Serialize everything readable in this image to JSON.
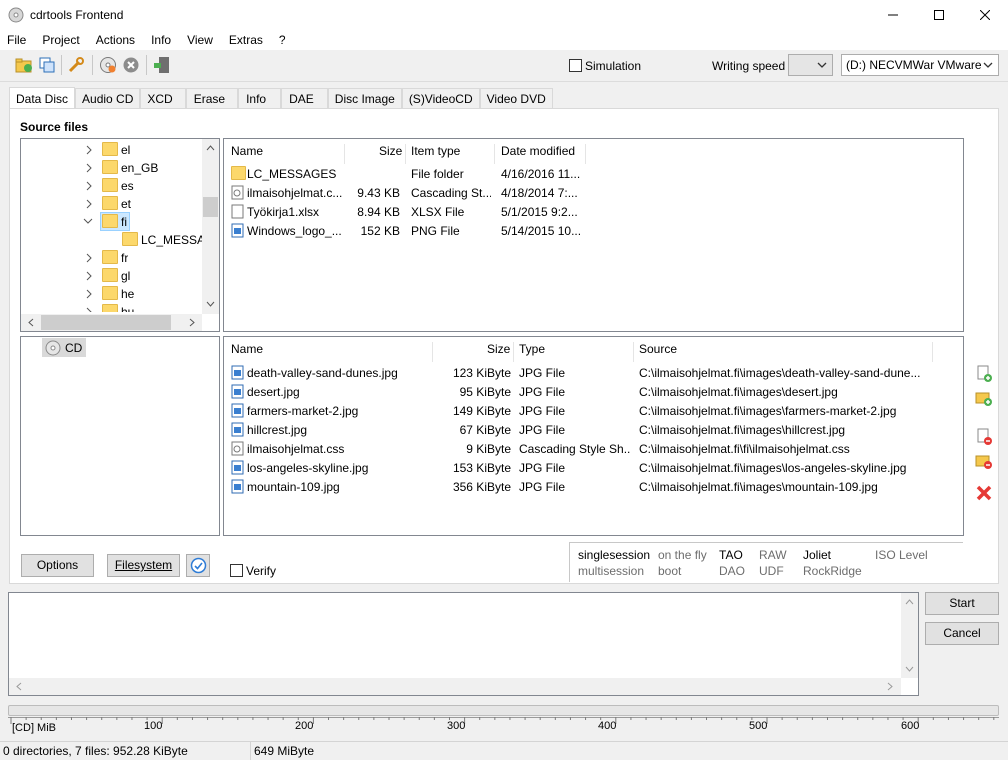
{
  "window": {
    "title": "cdrtools Frontend"
  },
  "menu": [
    "File",
    "Project",
    "Actions",
    "Info",
    "View",
    "Extras",
    "?"
  ],
  "toolbar": {
    "simulation_label": "Simulation",
    "writing_speed_label": "Writing speed",
    "writing_speed_value": "",
    "device_value": "(D:) NECVMWar VMware"
  },
  "tabs": [
    "Data Disc",
    "Audio CD",
    "XCD",
    "Erase",
    "Info",
    "DAE",
    "Disc Image",
    "(S)VideoCD",
    "Video DVD"
  ],
  "source": {
    "label": "Source files",
    "tree": [
      {
        "name": "el",
        "expanded": false
      },
      {
        "name": "en_GB",
        "expanded": false
      },
      {
        "name": "es",
        "expanded": false
      },
      {
        "name": "et",
        "expanded": false
      },
      {
        "name": "fi",
        "expanded": true
      },
      {
        "name": "LC_MESSAGES",
        "child": true
      },
      {
        "name": "fr",
        "expanded": false
      },
      {
        "name": "gl",
        "expanded": false
      },
      {
        "name": "he",
        "expanded": false
      },
      {
        "name": "hu",
        "expanded": false
      }
    ],
    "columns": [
      "Name",
      "Size",
      "Item type",
      "Date modified"
    ],
    "files": [
      {
        "name": "LC_MESSAGES",
        "size": "",
        "type": "File folder",
        "date": "4/16/2016 11...",
        "icon": "folder-icon"
      },
      {
        "name": "ilmaisohjelmat.c...",
        "size": "9.43 KB",
        "type": "Cascading St...",
        "date": "4/18/2014 7:...",
        "icon": "css-file-icon"
      },
      {
        "name": "Työkirja1.xlsx",
        "size": "8.94 KB",
        "type": "XLSX File",
        "date": "5/1/2015 9:2...",
        "icon": "file-icon"
      },
      {
        "name": "Windows_logo_...",
        "size": "152 KB",
        "type": "PNG File",
        "date": "5/14/2015 10...",
        "icon": "image-file-icon"
      }
    ]
  },
  "disc": {
    "tree_root": "CD",
    "columns": [
      "Name",
      "Size",
      "Type",
      "Source"
    ],
    "files": [
      {
        "name": "death-valley-sand-dunes.jpg",
        "size": "123 KiByte",
        "type": "JPG File",
        "source": "C:\\ilmaisohjelmat.fi\\images\\death-valley-sand-dune...",
        "icon": "image-file-icon"
      },
      {
        "name": "desert.jpg",
        "size": "95 KiByte",
        "type": "JPG File",
        "source": "C:\\ilmaisohjelmat.fi\\images\\desert.jpg",
        "icon": "image-file-icon"
      },
      {
        "name": "farmers-market-2.jpg",
        "size": "149 KiByte",
        "type": "JPG File",
        "source": "C:\\ilmaisohjelmat.fi\\images\\farmers-market-2.jpg",
        "icon": "image-file-icon"
      },
      {
        "name": "hillcrest.jpg",
        "size": "67 KiByte",
        "type": "JPG File",
        "source": "C:\\ilmaisohjelmat.fi\\images\\hillcrest.jpg",
        "icon": "image-file-icon"
      },
      {
        "name": "ilmaisohjelmat.css",
        "size": "9 KiByte",
        "type": "Cascading Style Sh...",
        "source": "C:\\ilmaisohjelmat.fi\\fi\\ilmaisohjelmat.css",
        "icon": "css-file-icon"
      },
      {
        "name": "los-angeles-skyline.jpg",
        "size": "153 KiByte",
        "type": "JPG File",
        "source": "C:\\ilmaisohjelmat.fi\\images\\los-angeles-skyline.jpg",
        "icon": "image-file-icon"
      },
      {
        "name": "mountain-109.jpg",
        "size": "356 KiByte",
        "type": "JPG File",
        "source": "C:\\ilmaisohjelmat.fi\\images\\mountain-109.jpg",
        "icon": "image-file-icon"
      }
    ]
  },
  "buttons": {
    "options": "Options",
    "filesystem": "Filesystem",
    "verify": "Verify",
    "start": "Start",
    "cancel": "Cancel"
  },
  "options_panel": {
    "row1": [
      {
        "text": "singlesession",
        "active": true
      },
      {
        "text": "on the fly",
        "active": false
      },
      {
        "text": "TAO",
        "active": true
      },
      {
        "text": "RAW",
        "active": false
      },
      {
        "text": "Joliet",
        "active": true
      },
      {
        "text": "ISO Level",
        "active": false
      }
    ],
    "row2": [
      {
        "text": "multisession",
        "active": false
      },
      {
        "text": "boot",
        "active": false
      },
      {
        "text": "DAO",
        "active": false
      },
      {
        "text": "UDF",
        "active": false
      },
      {
        "text": "RockRidge",
        "active": false
      }
    ]
  },
  "ruler": {
    "unit_label": "[CD] MiB",
    "ticks": [
      "100",
      "200",
      "300",
      "400",
      "500",
      "600"
    ]
  },
  "status": {
    "left": "0 directories, 7 files: 952.28 KiByte",
    "right": "649 MiByte"
  }
}
